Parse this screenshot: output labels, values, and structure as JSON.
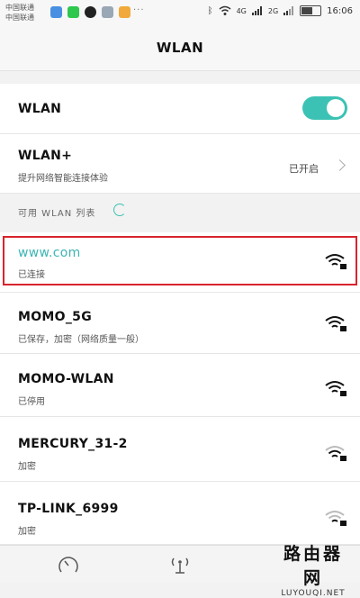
{
  "status_bar": {
    "carrier_line1": "中国联通",
    "carrier_line2": "中国联通",
    "time": "16:06",
    "signal1": "4G",
    "signal2": "2G",
    "dots": "···"
  },
  "header": {
    "title": "WLAN"
  },
  "wlan_toggle": {
    "label": "WLAN",
    "enabled": true
  },
  "wlan_plus": {
    "label": "WLAN+",
    "subtitle": "提升网络智能连接体验",
    "state": "已开启"
  },
  "available_header": {
    "label": "可用 WLAN 列表"
  },
  "networks": [
    {
      "ssid": "www.com",
      "status": "已连接",
      "signal": "strong",
      "secured": true
    },
    {
      "ssid": "MOMO_5G",
      "status": "已保存，加密（网络质量一般）",
      "signal": "strong",
      "secured": true
    },
    {
      "ssid": "MOMO-WLAN",
      "status": "已停用",
      "signal": "strong",
      "secured": true
    },
    {
      "ssid": "MERCURY_31-2",
      "status": "加密",
      "signal": "medium",
      "secured": true
    },
    {
      "ssid": "TP-LINK_6999",
      "status": "加密",
      "signal": "weak",
      "secured": true
    }
  ],
  "bottom_nav": {
    "icons": [
      "speedometer-icon",
      "wifi-antenna-icon"
    ]
  },
  "watermark": {
    "line1": "路由器网",
    "line2": "LUYOUQI.NET"
  }
}
